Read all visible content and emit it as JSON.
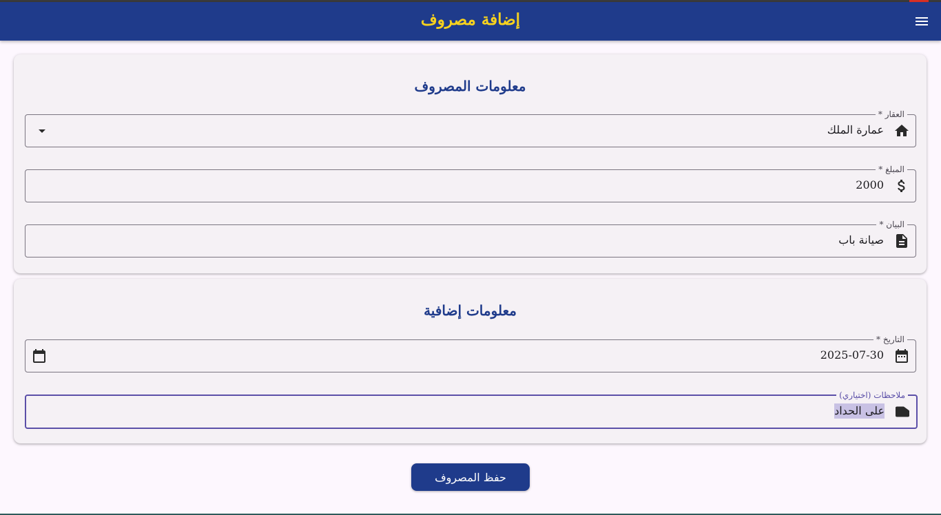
{
  "app_bar": {
    "title": "إضافة مصروف",
    "menu_icon": "menu-icon",
    "background": "#1f3b8b",
    "title_color": "#f7d21e"
  },
  "expense_info": {
    "title": "معلومات المصروف",
    "property": {
      "label": "العقار *",
      "value": "عمارة الملك",
      "icon": "home-icon"
    },
    "amount": {
      "label": "المبلغ *",
      "value": "2000",
      "icon": "dollar-icon"
    },
    "description": {
      "label": "البيان *",
      "value": "صيانة باب",
      "icon": "document-icon"
    }
  },
  "additional_info": {
    "title": "معلومات إضافية",
    "date": {
      "label": "التاريخ *",
      "value": "2025-07-30",
      "icon": "calendar-icon"
    },
    "notes": {
      "label": "ملاحظات (اختياري)",
      "value": "على الحداد",
      "icon": "note-icon"
    }
  },
  "save_button": {
    "label": "حفظ المصروف"
  },
  "colors": {
    "accent": "#1f3b8b",
    "focus": "#5b4fa8",
    "card": "#f5f1f5",
    "page": "#fdf7fe"
  }
}
